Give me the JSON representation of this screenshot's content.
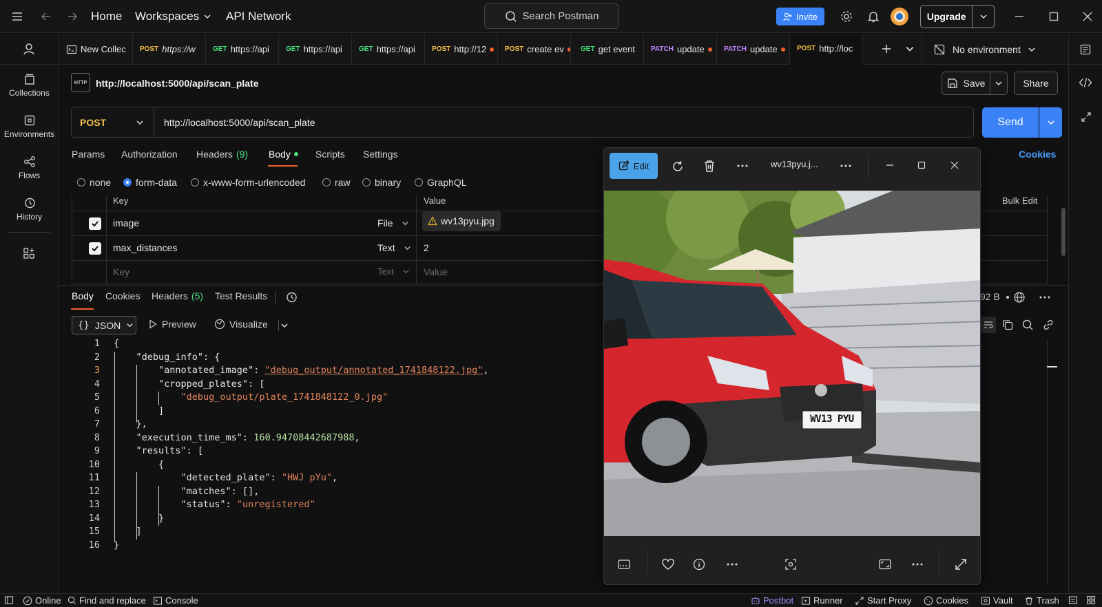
{
  "topbar": {
    "home": "Home",
    "workspaces": "Workspaces",
    "api_network": "API Network",
    "search_placeholder": "Search Postman",
    "invite": "Invite",
    "upgrade": "Upgrade"
  },
  "sidebar": {
    "items": [
      {
        "label": "Collections",
        "icon": "collections-icon"
      },
      {
        "label": "Environments",
        "icon": "environments-icon"
      },
      {
        "label": "Flows",
        "icon": "flows-icon"
      },
      {
        "label": "History",
        "icon": "history-icon"
      }
    ]
  },
  "tabs": [
    {
      "method": "",
      "label": "New Collec",
      "unsaved": false
    },
    {
      "method": "POST",
      "label": "https://w",
      "unsaved": false
    },
    {
      "method": "GET",
      "label": "https://api",
      "unsaved": false
    },
    {
      "method": "GET",
      "label": "https://api",
      "unsaved": false
    },
    {
      "method": "GET",
      "label": "https://api",
      "unsaved": false
    },
    {
      "method": "POST",
      "label": "http://12",
      "unsaved": true
    },
    {
      "method": "POST",
      "label": "create ev",
      "unsaved": true
    },
    {
      "method": "GET",
      "label": "get event",
      "unsaved": false
    },
    {
      "method": "PATCH",
      "label": "update",
      "unsaved": true
    },
    {
      "method": "PATCH",
      "label": "update",
      "unsaved": true
    },
    {
      "method": "POST",
      "label": "http://loc",
      "unsaved": false
    }
  ],
  "environment": "No environment",
  "request": {
    "title": "http://localhost:5000/api/scan_plate",
    "method": "POST",
    "url": "http://localhost:5000/api/scan_plate",
    "save": "Save",
    "share": "Share",
    "send": "Send",
    "cookies": "Cookies",
    "tabs": {
      "params": "Params",
      "authorization": "Authorization",
      "headers": "Headers",
      "headers_count": "(9)",
      "body": "Body",
      "scripts": "Scripts",
      "settings": "Settings"
    },
    "body_types": [
      "none",
      "form-data",
      "x-www-form-urlencoded",
      "raw",
      "binary",
      "GraphQL"
    ],
    "selected_body_type": "form-data",
    "form": {
      "key_header": "Key",
      "value_header": "Value",
      "bulk_edit": "Bulk Edit",
      "rows": [
        {
          "key": "image",
          "type": "File",
          "value": "wv13pyu.jpg",
          "checked": true
        },
        {
          "key": "max_distances",
          "type": "Text",
          "value": "2",
          "checked": true
        }
      ],
      "placeholder_key": "Key",
      "placeholder_type": "Text",
      "placeholder_value": "Value"
    }
  },
  "response": {
    "tabs": {
      "body": "Body",
      "cookies": "Cookies",
      "headers": "Headers",
      "headers_count": "(5)",
      "test_results": "Test Results"
    },
    "size": "92 B",
    "format": "JSON",
    "preview": "Preview",
    "visualize": "Visualize",
    "current_line": 3,
    "code": [
      {
        "n": "1",
        "t": [
          [
            "k",
            "{"
          ]
        ]
      },
      {
        "n": "2",
        "t": [
          [
            "k",
            "    \"debug_info\": {"
          ]
        ]
      },
      {
        "n": "3",
        "t": [
          [
            "k",
            "        \"annotated_image\": "
          ],
          [
            "s",
            "\"debug_output/annotated_1741848122.jpg\""
          ],
          [
            "k",
            ","
          ]
        ]
      },
      {
        "n": "4",
        "t": [
          [
            "k",
            "        \"cropped_plates\": ["
          ]
        ]
      },
      {
        "n": "5",
        "t": [
          [
            "s",
            "            \"debug_output/plate_1741848122_0.jpg\""
          ]
        ]
      },
      {
        "n": "6",
        "t": [
          [
            "k",
            "        ]"
          ]
        ]
      },
      {
        "n": "7",
        "t": [
          [
            "k",
            "    },"
          ]
        ]
      },
      {
        "n": "8",
        "t": [
          [
            "k",
            "    \"execution_time_ms\": "
          ],
          [
            "n",
            "160.94708442687988"
          ],
          [
            "k",
            ","
          ]
        ]
      },
      {
        "n": "9",
        "t": [
          [
            "k",
            "    \"results\": ["
          ]
        ]
      },
      {
        "n": "10",
        "t": [
          [
            "k",
            "        {"
          ]
        ]
      },
      {
        "n": "11",
        "t": [
          [
            "k",
            "            \"detected_plate\": "
          ],
          [
            "s",
            "\"HWJ pYu\""
          ],
          [
            "k",
            ","
          ]
        ]
      },
      {
        "n": "12",
        "t": [
          [
            "k",
            "            \"matches\": [],"
          ]
        ]
      },
      {
        "n": "13",
        "t": [
          [
            "k",
            "            \"status\": "
          ],
          [
            "s",
            "\"unregistered\""
          ]
        ]
      },
      {
        "n": "14",
        "t": [
          [
            "k",
            "        }"
          ]
        ]
      },
      {
        "n": "15",
        "t": [
          [
            "k",
            "    ]"
          ]
        ]
      },
      {
        "n": "16",
        "t": [
          [
            "k",
            "}"
          ]
        ]
      }
    ]
  },
  "viewer": {
    "edit": "Edit",
    "filename": "wv13pyu.j...",
    "plate_text": "WV13 PYU"
  },
  "statusbar": {
    "online": "Online",
    "find_replace": "Find and replace",
    "console": "Console",
    "postbot": "Postbot",
    "runner": "Runner",
    "start_proxy": "Start Proxy",
    "cookies": "Cookies",
    "vault": "Vault",
    "trash": "Trash"
  },
  "colors": {
    "accent": "#3b82f6",
    "post": "#f5c04a",
    "get": "#4ade80",
    "patch": "#c084fc",
    "unsaved_dot": "#f0602c",
    "postbot": "#a78bfa"
  }
}
